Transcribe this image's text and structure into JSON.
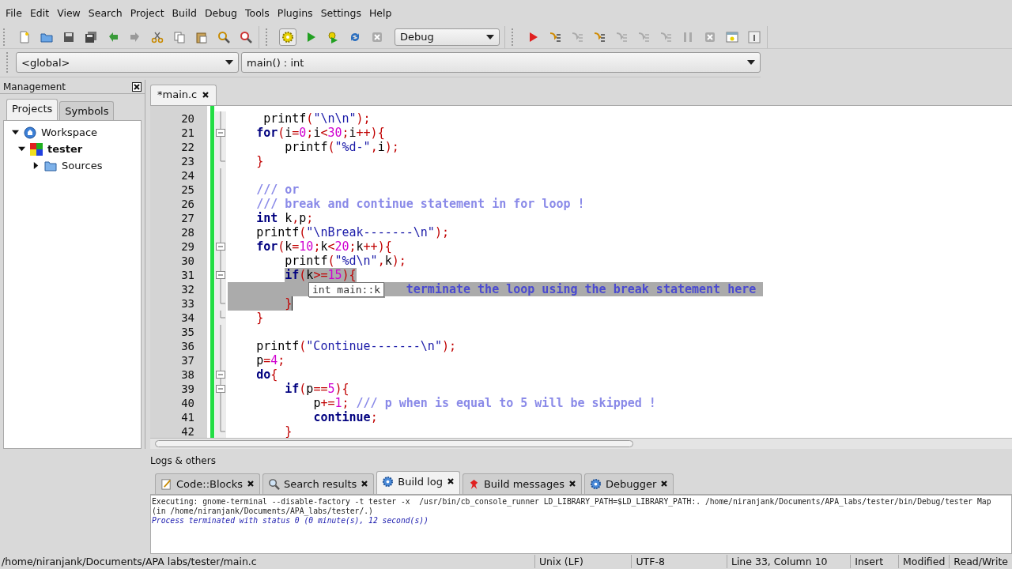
{
  "menu": [
    "File",
    "Edit",
    "View",
    "Search",
    "Project",
    "Build",
    "Debug",
    "Tools",
    "Plugins",
    "Settings",
    "Help"
  ],
  "toolbar": {
    "build_target": "Debug"
  },
  "code_toolbar": {
    "scope": "<global>",
    "function": "main() : int"
  },
  "management": {
    "title": "Management",
    "tabs": [
      {
        "label": "Projects",
        "selected": true
      },
      {
        "label": "Symbols",
        "selected": false
      }
    ],
    "tree": [
      {
        "label": "Workspace",
        "kind": "workspace",
        "expanded": true,
        "children": [
          {
            "label": "tester",
            "kind": "project",
            "expanded": true,
            "children": [
              {
                "label": "Sources",
                "kind": "folder",
                "expanded": false
              }
            ]
          }
        ]
      }
    ]
  },
  "editor": {
    "tabs": [
      {
        "label": "*main.c",
        "selected": true
      }
    ],
    "tooltip": "int main::k",
    "lines": [
      {
        "number": "20",
        "kind": "body",
        "selected": false,
        "tokens": [
          {
            "kind": "id",
            "text": "     printf"
          },
          {
            "kind": "op",
            "text": "("
          },
          {
            "kind": "str",
            "text": "\"\\n\\n\""
          },
          {
            "kind": "op",
            "text": ");"
          }
        ]
      },
      {
        "number": "21",
        "kind": "fold_start",
        "selected": false,
        "tokens": [
          {
            "kind": "kw",
            "text": "    for"
          },
          {
            "kind": "op",
            "text": "("
          },
          {
            "kind": "id",
            "text": "i"
          },
          {
            "kind": "op",
            "text": "="
          },
          {
            "kind": "num",
            "text": "0"
          },
          {
            "kind": "op",
            "text": ";"
          },
          {
            "kind": "id",
            "text": "i"
          },
          {
            "kind": "op",
            "text": "<"
          },
          {
            "kind": "num",
            "text": "30"
          },
          {
            "kind": "op",
            "text": ";"
          },
          {
            "kind": "id",
            "text": "i"
          },
          {
            "kind": "op",
            "text": "++){"
          }
        ]
      },
      {
        "number": "22",
        "kind": "body",
        "selected": false,
        "tokens": [
          {
            "kind": "id",
            "text": "        printf"
          },
          {
            "kind": "op",
            "text": "("
          },
          {
            "kind": "str",
            "text": "\"%d-\""
          },
          {
            "kind": "op",
            "text": ","
          },
          {
            "kind": "id",
            "text": "i"
          },
          {
            "kind": "op",
            "text": ");"
          }
        ]
      },
      {
        "number": "23",
        "kind": "fold_end",
        "selected": false,
        "tokens": [
          {
            "kind": "op",
            "text": "    }"
          }
        ]
      },
      {
        "number": "24",
        "kind": "body",
        "selected": false
      },
      {
        "number": "25",
        "kind": "body",
        "selected": false,
        "tokens": [
          {
            "kind": "com",
            "text": "    /// or"
          }
        ]
      },
      {
        "number": "26",
        "kind": "body",
        "selected": false,
        "tokens": [
          {
            "kind": "com",
            "text": "    /// break and continue statement in for loop !"
          }
        ]
      },
      {
        "number": "27",
        "kind": "body",
        "selected": false,
        "tokens": [
          {
            "kind": "kw",
            "text": "    int"
          },
          {
            "kind": "id",
            "text": " k"
          },
          {
            "kind": "op",
            "text": ","
          },
          {
            "kind": "id",
            "text": "p"
          },
          {
            "kind": "op",
            "text": ";"
          }
        ]
      },
      {
        "number": "28",
        "kind": "body",
        "selected": false,
        "tokens": [
          {
            "kind": "id",
            "text": "    printf"
          },
          {
            "kind": "op",
            "text": "("
          },
          {
            "kind": "str",
            "text": "\"\\nBreak-------\\n\""
          },
          {
            "kind": "op",
            "text": ");"
          }
        ]
      },
      {
        "number": "29",
        "kind": "fold_start",
        "selected": false,
        "tokens": [
          {
            "kind": "kw",
            "text": "    for"
          },
          {
            "kind": "op",
            "text": "("
          },
          {
            "kind": "id",
            "text": "k"
          },
          {
            "kind": "op",
            "text": "="
          },
          {
            "kind": "num",
            "text": "10"
          },
          {
            "kind": "op",
            "text": ";"
          },
          {
            "kind": "id",
            "text": "k"
          },
          {
            "kind": "op",
            "text": "<"
          },
          {
            "kind": "num",
            "text": "20"
          },
          {
            "kind": "op",
            "text": ";"
          },
          {
            "kind": "id",
            "text": "k"
          },
          {
            "kind": "op",
            "text": "++){"
          }
        ]
      },
      {
        "number": "30",
        "kind": "body",
        "selected": false,
        "tokens": [
          {
            "kind": "id",
            "text": "        printf"
          },
          {
            "kind": "op",
            "text": "("
          },
          {
            "kind": "str",
            "text": "\"%d\\n\""
          },
          {
            "kind": "op",
            "text": ","
          },
          {
            "kind": "id",
            "text": "k"
          },
          {
            "kind": "op",
            "text": ");"
          }
        ]
      },
      {
        "number": "31",
        "kind": "fold_start",
        "selected": true,
        "tokens": [
          {
            "kind": "kw",
            "text": "        if"
          },
          {
            "kind": "op",
            "text": "("
          },
          {
            "kind": "id",
            "text": "k"
          },
          {
            "kind": "op",
            "text": ">="
          },
          {
            "kind": "num",
            "text": "15"
          },
          {
            "kind": "op",
            "text": "){"
          }
        ]
      },
      {
        "number": "32",
        "kind": "body",
        "selected": true,
        "tokens": [
          {
            "kind": "com",
            "text": "                         terminate the loop using the break statement here"
          }
        ]
      },
      {
        "number": "33",
        "kind": "fold_end",
        "selected": true,
        "caret": true,
        "tokens": [
          {
            "kind": "op",
            "text": "        }"
          }
        ]
      },
      {
        "number": "34",
        "kind": "fold_end",
        "selected": false,
        "tokens": [
          {
            "kind": "op",
            "text": "    }"
          }
        ]
      },
      {
        "number": "35",
        "kind": "body",
        "selected": false
      },
      {
        "number": "36",
        "kind": "body",
        "selected": false,
        "tokens": [
          {
            "kind": "id",
            "text": "    printf"
          },
          {
            "kind": "op",
            "text": "("
          },
          {
            "kind": "str",
            "text": "\"Continue-------\\n\""
          },
          {
            "kind": "op",
            "text": ");"
          }
        ]
      },
      {
        "number": "37",
        "kind": "body",
        "selected": false,
        "tokens": [
          {
            "kind": "id",
            "text": "    p"
          },
          {
            "kind": "op",
            "text": "="
          },
          {
            "kind": "num",
            "text": "4"
          },
          {
            "kind": "op",
            "text": ";"
          }
        ]
      },
      {
        "number": "38",
        "kind": "fold_start",
        "selected": false,
        "tokens": [
          {
            "kind": "kw",
            "text": "    do"
          },
          {
            "kind": "op",
            "text": "{"
          }
        ]
      },
      {
        "number": "39",
        "kind": "fold_start",
        "selected": false,
        "tokens": [
          {
            "kind": "kw",
            "text": "        if"
          },
          {
            "kind": "op",
            "text": "("
          },
          {
            "kind": "id",
            "text": "p"
          },
          {
            "kind": "op",
            "text": "=="
          },
          {
            "kind": "num",
            "text": "5"
          },
          {
            "kind": "op",
            "text": "){"
          }
        ]
      },
      {
        "number": "40",
        "kind": "body",
        "selected": false,
        "tokens": [
          {
            "kind": "id",
            "text": "            p"
          },
          {
            "kind": "op",
            "text": "+="
          },
          {
            "kind": "num",
            "text": "1"
          },
          {
            "kind": "op",
            "text": ";"
          },
          {
            "kind": "com",
            "text": " /// p when is equal to 5 will be skipped !"
          }
        ]
      },
      {
        "number": "41",
        "kind": "body",
        "selected": false,
        "tokens": [
          {
            "kind": "kw",
            "text": "            continue"
          },
          {
            "kind": "op",
            "text": ";"
          }
        ]
      },
      {
        "number": "42",
        "kind": "fold_end",
        "selected": false,
        "tokens": [
          {
            "kind": "op",
            "text": "        }"
          }
        ]
      }
    ]
  },
  "logs": {
    "title": "Logs & others",
    "tabs": [
      {
        "label": "Code::Blocks",
        "kind": "note",
        "selected": false
      },
      {
        "label": "Search results",
        "kind": "search",
        "selected": false
      },
      {
        "label": "Build log",
        "kind": "gear",
        "selected": true
      },
      {
        "label": "Build messages",
        "kind": "pin",
        "selected": false
      },
      {
        "label": "Debugger",
        "kind": "gear",
        "selected": false
      }
    ],
    "lines": [
      {
        "kind": "normal",
        "text": "Executing: gnome-terminal --disable-factory -t tester -x  /usr/bin/cb_console_runner LD_LIBRARY_PATH=$LD_LIBRARY_PATH:. /home/niranjank/Documents/APA_labs/tester/bin/Debug/tester Map"
      },
      {
        "kind": "normal",
        "text": "(in /home/niranjank/Documents/APA_labs/tester/.)"
      },
      {
        "kind": "status",
        "text": "Process terminated with status 0 (0 minute(s), 12 second(s))"
      }
    ]
  },
  "status_bar": [
    "/home/niranjank/Documents/APA labs/tester/main.c",
    "Unix (LF)",
    "UTF-8",
    "Line 33, Column 10",
    "Insert",
    "Modified",
    "Read/Write"
  ]
}
